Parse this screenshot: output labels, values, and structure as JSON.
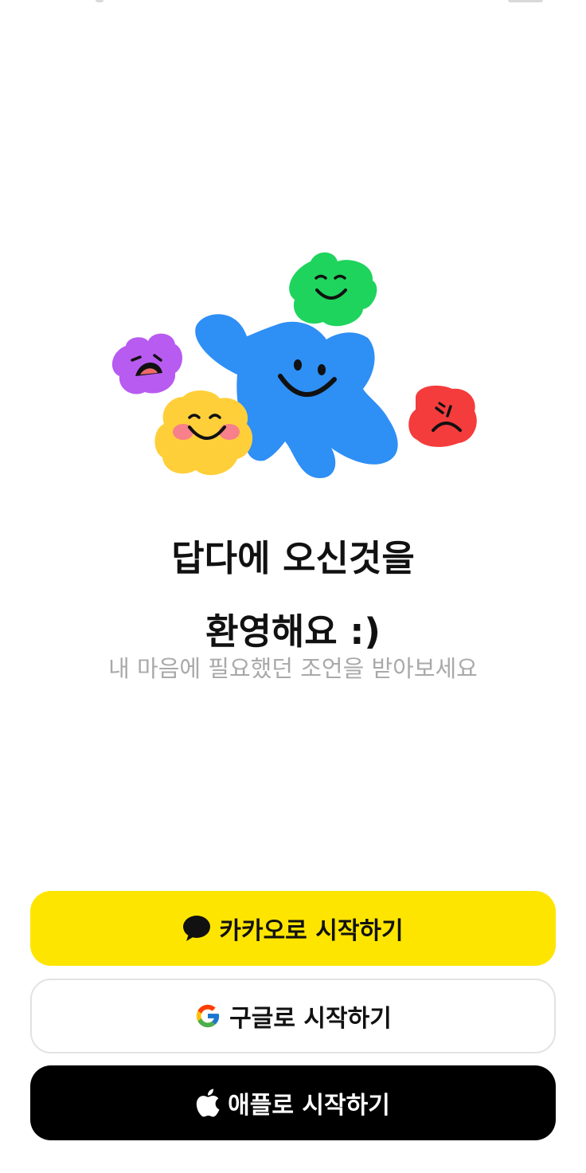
{
  "colors": {
    "kakao_yellow": "#FEE500",
    "apple_black": "#000000",
    "character_blue": "#2E8FF5",
    "character_green": "#1FD45C",
    "character_purple": "#B85BF0",
    "character_yellow": "#FFCF3A",
    "character_red": "#F43C3C",
    "subtitle_gray": "#A9A9A9"
  },
  "welcome": {
    "title_line1": "답다에 오신것을",
    "title_line2": "환영해요 :)",
    "subtitle": "내 마음에 필요했던 조언을 받아보세요"
  },
  "login": {
    "kakao": {
      "label": "카카오로 시작하기",
      "icon": "kakao-speech-bubble-icon"
    },
    "google": {
      "label": "구글로 시작하기",
      "icon": "google-g-icon"
    },
    "apple": {
      "label": "애플로 시작하기",
      "icon": "apple-logo-icon"
    }
  }
}
